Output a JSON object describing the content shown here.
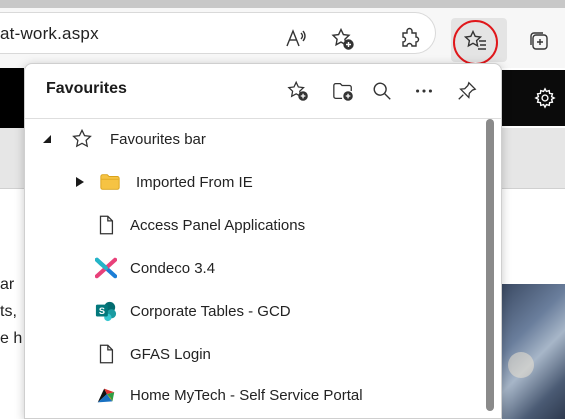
{
  "address_bar": {
    "url_text": "at-work.aspx"
  },
  "toolbar_icons": [
    "read-aloud-icon",
    "add-favourite-icon",
    "extensions-icon",
    "favourites-icon",
    "collections-icon"
  ],
  "panel": {
    "title": "Favourites",
    "header_icons": [
      "add-page-to-favourites-icon",
      "add-folder-icon",
      "search-icon",
      "more-options-icon",
      "pin-icon"
    ],
    "items": [
      {
        "label": "Favourites bar",
        "type": "folder-root",
        "expanded": true,
        "icon": "star-outline-icon"
      },
      {
        "label": "Imported From IE",
        "type": "folder",
        "expanded": false,
        "icon": "folder-icon"
      },
      {
        "label": "Access Panel Applications",
        "type": "link",
        "icon": "page-icon"
      },
      {
        "label": "Condeco 3.4",
        "type": "link",
        "icon": "condeco-logo-icon"
      },
      {
        "label": "Corporate Tables - GCD",
        "type": "link",
        "icon": "sharepoint-logo-icon"
      },
      {
        "label": "GFAS Login",
        "type": "link",
        "icon": "page-icon"
      },
      {
        "label": "Home MyTech - Self Service Portal",
        "type": "link",
        "icon": "mytech-logo-icon"
      }
    ]
  },
  "background_page": {
    "fragments": [
      "ar",
      "ts,",
      "e h"
    ]
  },
  "colors": {
    "highlight_circle": "#e0171b",
    "folder": "#f6c343",
    "sharepoint": "#0364b8",
    "condeco_blue": "#1c7ed6",
    "condeco_pink": "#e8417a"
  }
}
